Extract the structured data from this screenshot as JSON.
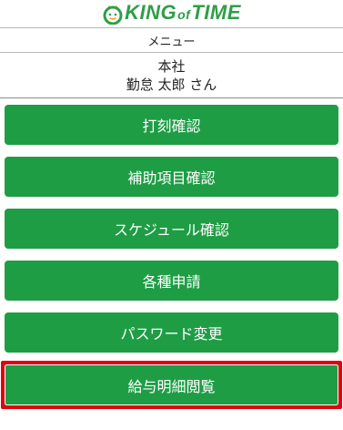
{
  "header": {
    "logo_main": "KING",
    "logo_small": "of",
    "logo_end": "TIME",
    "logo_icon": "king-of-time-mascot-icon"
  },
  "menu": {
    "title": "メニュー"
  },
  "user": {
    "company": "本社",
    "name": "勤怠 太郎 さん"
  },
  "buttons": [
    {
      "label": "打刻確認"
    },
    {
      "label": "補助項目確認"
    },
    {
      "label": "スケジュール確認"
    },
    {
      "label": "各種申請"
    },
    {
      "label": "パスワード変更"
    },
    {
      "label": "給与明細閲覧",
      "selected": true
    }
  ],
  "colors": {
    "button_green": "#1e9d45",
    "logo_green": "#2e9e48",
    "highlight_red": "#e3000f",
    "logo_orange": "#f5a623"
  }
}
